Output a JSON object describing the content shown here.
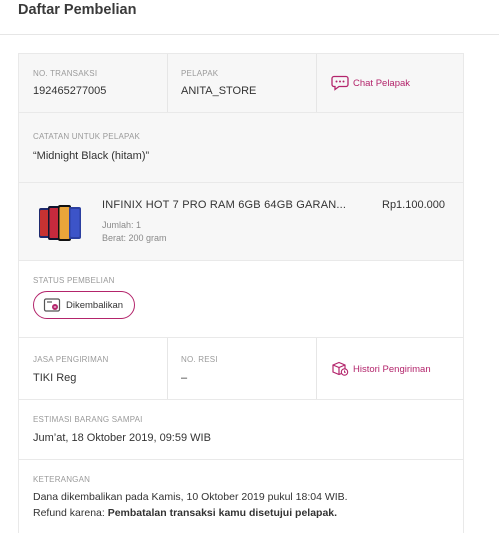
{
  "header": {
    "title": "Daftar Pembelian"
  },
  "transaction": {
    "no_label": "NO. TRANSAKSI",
    "no_value": "192465277005",
    "seller_label": "PELAPAK",
    "seller_value": "ANITA_STORE",
    "chat_label": "Chat Pelapak"
  },
  "note_for_seller": {
    "label": "CATATAN UNTUK PELAPAK",
    "value": "“Midnight Black (hitam)”"
  },
  "product": {
    "name": "INFINIX HOT 7 PRO RAM 6GB 64GB GARAN...",
    "qty": "Jumlah: 1",
    "weight": "Berat: 200 gram",
    "price": "Rp1.100.000"
  },
  "status": {
    "label": "STATUS PEMBELIAN",
    "badge": "Dikembalikan",
    "accent": "#b3246b"
  },
  "shipping": {
    "service_label": "JASA PENGIRIMAN",
    "service_value": "TIKI Reg",
    "resi_label": "NO. RESI",
    "resi_value": "–",
    "history_label": "Histori Pengiriman"
  },
  "estimate": {
    "label": "ESTIMASI BARANG SAMPAI",
    "value": "Jum’at, 18 Oktober 2019, 09:59 WIB"
  },
  "remarks": {
    "label": "KETERANGAN",
    "line1": "Dana dikembalikan pada Kamis, 10 Oktober 2019 pukul 18:04 WIB.",
    "line2_prefix": "Refund karena: ",
    "line2_bold": "Pembatalan transaksi kamu disetujui pelapak."
  }
}
